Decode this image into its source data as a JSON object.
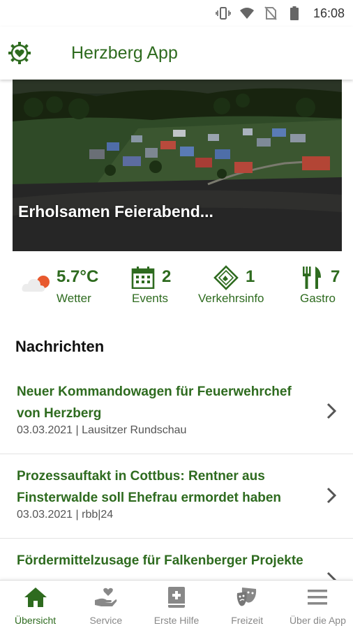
{
  "statusbar": {
    "time": "16:08"
  },
  "appbar": {
    "title": "Herzberg App"
  },
  "hero": {
    "caption": "Erholsamen Feierabend..."
  },
  "info": [
    {
      "value": "5.7°C",
      "label": "Wetter"
    },
    {
      "value": "2",
      "label": "Events"
    },
    {
      "value": "1",
      "label": "Verkehrsinfo"
    },
    {
      "value": "7",
      "label": "Gastro"
    }
  ],
  "news": {
    "title": "Nachrichten",
    "items": [
      {
        "headline": "Neuer Kommandowagen für Feuerwehrchef von Herzberg",
        "meta": "03.03.2021 | Lausitzer Rundschau"
      },
      {
        "headline": "Prozessauftakt in Cottbus: Rentner aus Finsterwalde soll Ehefrau ermordet haben",
        "meta": "03.03.2021 | rbb|24"
      },
      {
        "headline": "Fördermittelzusage für Falkenberger Projekte",
        "meta": ""
      }
    ]
  },
  "nav": [
    {
      "label": "Übersicht"
    },
    {
      "label": "Service"
    },
    {
      "label": "Erste Hilfe"
    },
    {
      "label": "Freizeit"
    },
    {
      "label": "Über die App"
    }
  ],
  "colors": {
    "primary": "#2e6b1f",
    "muted": "#888888"
  }
}
